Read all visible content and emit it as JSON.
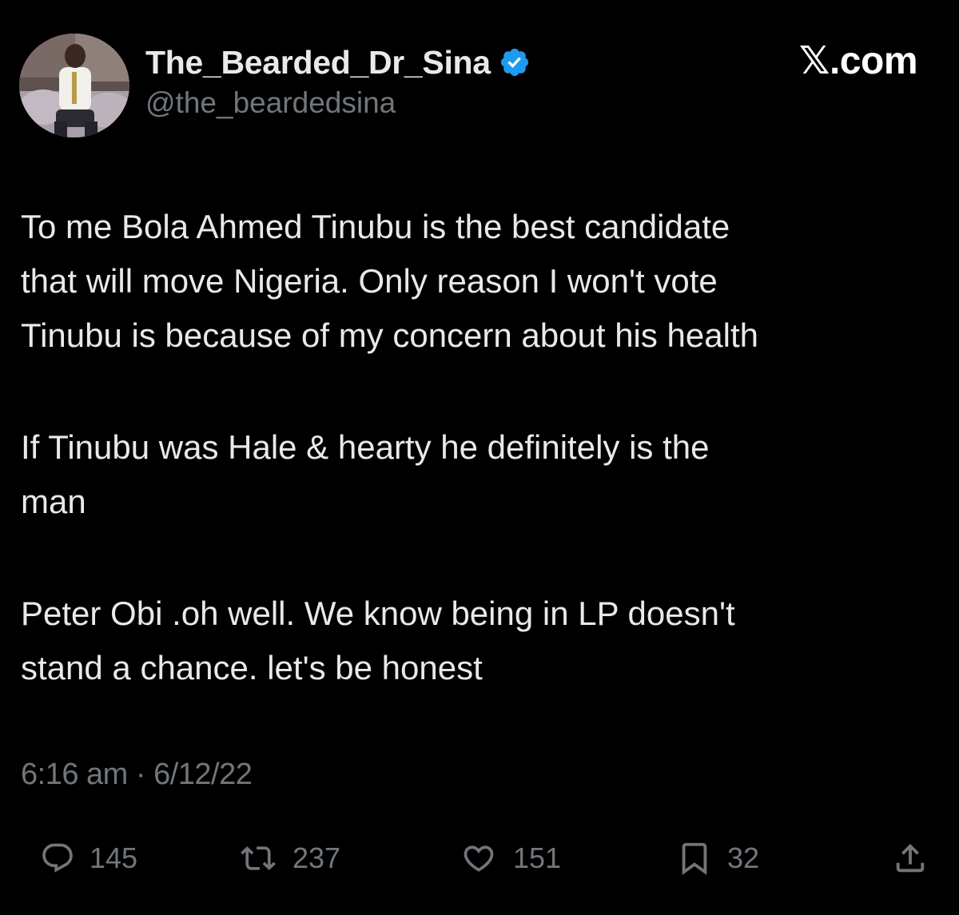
{
  "author": {
    "display_name": "The_Bearded_Dr_Sina",
    "handle": "@the_beardedsina",
    "verified": true,
    "avatar_icon": "profile-photo"
  },
  "brand": {
    "label": "𝕏.com"
  },
  "tweet": {
    "paragraphs": [
      "To me Bola Ahmed Tinubu is the best candidate\nthat will move Nigeria. Only reason I won't vote\nTinubu is because of my concern about his health",
      "If Tinubu was Hale & hearty he definitely is the\nman",
      "Peter Obi .oh well. We know being in LP doesn't\nstand a chance. let's be honest"
    ],
    "time": "6:16 am",
    "separator": "·",
    "date": "6/12/22"
  },
  "actions": {
    "reply": {
      "icon": "reply-icon",
      "count": "145"
    },
    "repost": {
      "icon": "repost-icon",
      "count": "237"
    },
    "like": {
      "icon": "heart-icon",
      "count": "151"
    },
    "bookmark": {
      "icon": "bookmark-icon",
      "count": "32"
    },
    "share": {
      "icon": "share-icon"
    }
  },
  "colors": {
    "background": "#000000",
    "text": "#e7e9ea",
    "secondary": "#71767b",
    "verified": "#1d9bf0"
  }
}
